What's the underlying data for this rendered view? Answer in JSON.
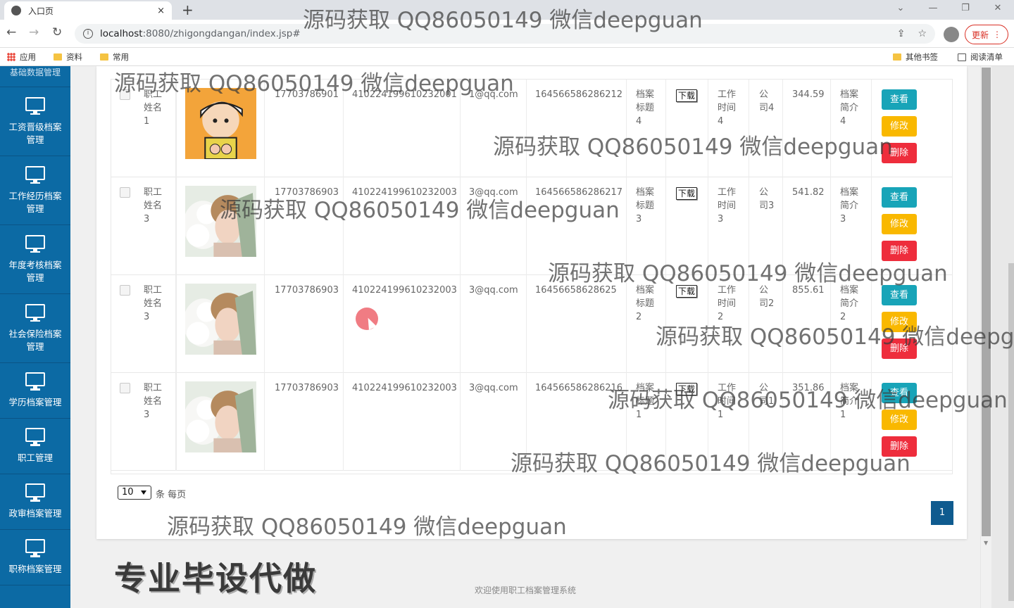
{
  "browser": {
    "tab_title": "入口页",
    "tab_close": "×",
    "new_tab": "+",
    "url_host": "localhost",
    "url_rest": ":8080/zhigongdangan/index.jsp#",
    "update_label": "更新",
    "window_controls": [
      "⌄",
      "—",
      "❐",
      "✕"
    ],
    "bookmarks": [
      "应用",
      "资料",
      "常用"
    ],
    "bookmarks_right": [
      "其他书签",
      "阅读清单"
    ]
  },
  "sidebar": {
    "top_partial": "基础数据管理",
    "items": [
      {
        "label": "工资晋级档案管理",
        "icon": "monitor-icon"
      },
      {
        "label": "工作经历档案管理",
        "icon": "monitor-icon"
      },
      {
        "label": "年度考核档案管理",
        "icon": "monitor-icon"
      },
      {
        "label": "社会保险档案管理",
        "icon": "monitor-icon"
      },
      {
        "label": "学历档案管理",
        "icon": "monitor-icon"
      },
      {
        "label": "职工管理",
        "icon": "monitor-icon"
      },
      {
        "label": "政审档案管理",
        "icon": "monitor-icon"
      },
      {
        "label": "职称档案管理",
        "icon": "monitor-icon"
      }
    ]
  },
  "table": {
    "download_label": "下载",
    "actions": {
      "view": "查看",
      "edit": "修改",
      "delete": "删除"
    },
    "rows": [
      {
        "name": "职工姓名1",
        "phone": "17703786901",
        "idcard": "410224199610232001",
        "email": "1@qq.com",
        "number": "164566586286212",
        "title": "档案标题4",
        "work_time": "工作时间4",
        "company": "公司4",
        "amount": "344.59",
        "intro": "档案简介4",
        "photo": "cartoon"
      },
      {
        "name": "职工姓名3",
        "phone": "17703786903",
        "idcard": "410224199610232003",
        "email": "3@qq.com",
        "number": "164566586286217",
        "title": "档案标题3",
        "work_time": "工作时间3",
        "company": "公司3",
        "amount": "541.82",
        "intro": "档案简介3",
        "photo": "portrait"
      },
      {
        "name": "职工姓名3",
        "phone": "17703786903",
        "idcard": "410224199610232003",
        "email": "3@qq.com",
        "number": "16456658628625",
        "title": "档案标题2",
        "work_time": "工作时间2",
        "company": "公司2",
        "amount": "855.61",
        "intro": "档案简介2",
        "photo": "portrait"
      },
      {
        "name": "职工姓名3",
        "phone": "17703786903",
        "idcard": "410224199610232003",
        "email": "3@qq.com",
        "number": "164566586286216",
        "title": "档案标题1",
        "work_time": "工作时间1",
        "company": "公司1",
        "amount": "351.86",
        "intro": "档案简介1",
        "photo": "portrait"
      }
    ]
  },
  "pager": {
    "page_size": "10",
    "per_page_label": "条 每页",
    "current_page": "1"
  },
  "footer": "欢迎使用职工档案管理系统",
  "watermark": "源码获取 QQ86050149 微信deepguan",
  "promo": "专业毕设代做"
}
